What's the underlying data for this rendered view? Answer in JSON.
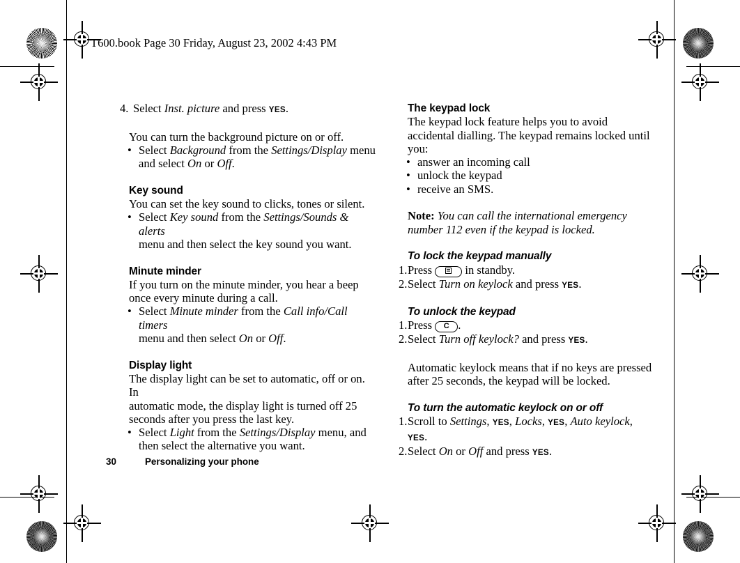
{
  "header": {
    "file_info": "T600.book  Page 30  Friday, August 23, 2002  4:43 PM"
  },
  "footer": {
    "page_number": "30",
    "section_title": "Personalizing your phone"
  },
  "left_column": {
    "step4": {
      "marker": "4.",
      "text_before": "Select ",
      "italic": "Inst. picture",
      "text_mid": " and press ",
      "smallcaps": "YES",
      "text_after": "."
    },
    "background_para": "You can turn the background picture on or off.",
    "background_bullet": {
      "marker": "•",
      "line1_a": "Select ",
      "line1_i1": "Background",
      "line1_b": " from the ",
      "line1_i2": "Settings/Display",
      "line1_c": " menu",
      "line2_a": "and select ",
      "line2_i1": "On",
      "line2_b": " or ",
      "line2_i2": "Off",
      "line2_c": "."
    },
    "key_sound": {
      "heading": "Key sound",
      "para": "You can set the key sound to clicks, tones or silent.",
      "bullet": {
        "marker": "•",
        "line1_a": "Select ",
        "line1_i1": "Key sound",
        "line1_b": " from the ",
        "line1_i2": "Settings/Sounds & alerts",
        "line2": "menu and then select the key sound you want."
      }
    },
    "minute_minder": {
      "heading": "Minute minder",
      "para_line1": "If you turn on the minute minder, you hear a beep",
      "para_line2": "once every minute during a call.",
      "bullet": {
        "marker": "•",
        "line1_a": "Select ",
        "line1_i1": "Minute minder",
        "line1_b": " from the ",
        "line1_i2": "Call info/Call timers",
        "line2_a": "menu and then select ",
        "line2_i1": "On",
        "line2_b": " or ",
        "line2_i2": "Off",
        "line2_c": "."
      }
    },
    "display_light": {
      "heading": "Display light",
      "para_line1": "The display light can be set to automatic, off or on. In",
      "para_line2": "automatic mode, the display light is turned off 25",
      "para_line3": "seconds after you press the last key.",
      "bullet": {
        "marker": "•",
        "line1_a": "Select ",
        "line1_i1": "Light",
        "line1_b": " from the ",
        "line1_i2": "Settings/Display",
        "line1_c": " menu, and",
        "line2": "then select the alternative you want."
      }
    }
  },
  "right_column": {
    "keypad_lock": {
      "heading": "The keypad lock",
      "para_line1": "The keypad lock feature helps you to avoid",
      "para_line2": "accidental dialling. The keypad remains locked until",
      "para_line3": "you:",
      "bullets": [
        {
          "marker": "•",
          "text": "answer an incoming call"
        },
        {
          "marker": "•",
          "text": "unlock the keypad"
        },
        {
          "marker": "•",
          "text": "receive an SMS."
        }
      ]
    },
    "note": {
      "label": "Note:",
      "line1": " You can call the international emergency",
      "line2": "number 112 even if the keypad is locked."
    },
    "lock_manually": {
      "heading": "To lock the keypad manually",
      "step1": {
        "marker": "1.",
        "text_before": "Press ",
        "key_icon": "menu-key-icon",
        "text_after": " in standby."
      },
      "step2": {
        "marker": "2.",
        "text_before": "Select ",
        "italic": "Turn on keylock",
        "text_mid": " and press ",
        "smallcaps": "YES",
        "text_after": "."
      }
    },
    "unlock": {
      "heading": "To unlock the keypad",
      "step1": {
        "marker": "1.",
        "text_before": "Press ",
        "key_label": "C",
        "text_after": "."
      },
      "step2": {
        "marker": "2.",
        "text_before": "Select ",
        "italic": "Turn off keylock?",
        "text_mid": " and press ",
        "smallcaps": "YES",
        "text_after": "."
      }
    },
    "auto_para_line1": "Automatic keylock means that if no keys are pressed",
    "auto_para_line2": "after 25 seconds, the keypad will be locked.",
    "auto_keylock": {
      "heading": "To turn the automatic keylock on or off",
      "step1": {
        "marker": "1.",
        "a": "Scroll to ",
        "i1": "Settings",
        "b": ", ",
        "sc1": "YES",
        "c": ", ",
        "i2": "Locks",
        "d": ", ",
        "sc2": "YES",
        "e": ", ",
        "i3": "Auto keylock",
        "f": ", ",
        "sc3": "YES",
        "g": "."
      },
      "step2": {
        "marker": "2.",
        "a": "Select ",
        "i1": "On",
        "b": " or ",
        "i2": "Off",
        "c": " and press ",
        "sc1": "YES",
        "d": "."
      }
    }
  }
}
